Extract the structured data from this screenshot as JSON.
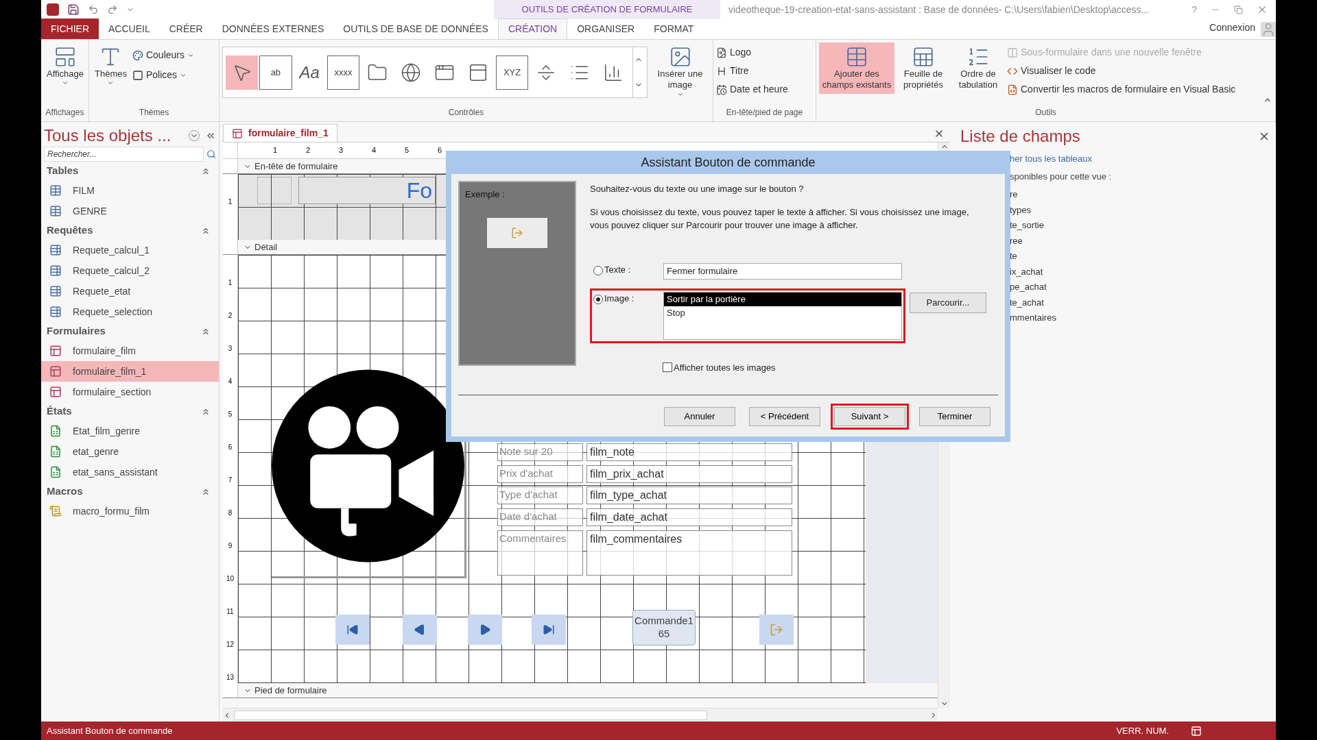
{
  "title_bar": {
    "context_label": "OUTILS DE CRÉATION DE FORMULAIRE",
    "title": "videotheque-19-creation-etat-sans-assistant : Base de données- C:\\Users\\fabien\\Desktop\\access...",
    "help": "?"
  },
  "ribbon_tabs": [
    {
      "label": "FICHIER",
      "kind": "file",
      "selected": false
    },
    {
      "label": "ACCUEIL",
      "kind": "tab",
      "selected": false
    },
    {
      "label": "CRÉER",
      "kind": "tab",
      "selected": false
    },
    {
      "label": "DONNÉES EXTERNES",
      "kind": "tab",
      "selected": false
    },
    {
      "label": "OUTILS DE BASE DE DONNÉES",
      "kind": "tab",
      "selected": false
    },
    {
      "label": "CRÉATION",
      "kind": "tab",
      "selected": true
    },
    {
      "label": "ORGANISER",
      "kind": "tab",
      "selected": false
    },
    {
      "label": "FORMAT",
      "kind": "tab",
      "selected": false
    }
  ],
  "account": "Connexion",
  "ribbon": {
    "views": {
      "label": "Affichages",
      "button": "Affichage"
    },
    "themes": {
      "label": "Thèmes",
      "button": "Thèmes",
      "colors": "Couleurs",
      "fonts": "Polices"
    },
    "controls": {
      "label": "Contrôles",
      "insert_image": "Insérer une image",
      "gallery": [
        {
          "kind": "pointer",
          "selected": true
        },
        {
          "kind": "glyph",
          "glyph": "ab",
          "selected": false
        },
        {
          "kind": "label",
          "glyph": "Aa",
          "selected": false
        },
        {
          "kind": "glyph",
          "glyph": "xxxx",
          "selected": false
        },
        {
          "kind": "folder",
          "selected": false
        },
        {
          "kind": "globe",
          "selected": false
        },
        {
          "kind": "browser",
          "selected": false
        },
        {
          "kind": "window",
          "selected": false
        },
        {
          "kind": "glyph",
          "glyph": "XYZ",
          "selected": false
        },
        {
          "kind": "pagebreak",
          "selected": false
        },
        {
          "kind": "list",
          "selected": false
        },
        {
          "kind": "chart",
          "selected": false
        }
      ]
    },
    "header_footer": {
      "label": "En-tête/pied de page",
      "items": [
        {
          "kind": "logo",
          "label": "Logo"
        },
        {
          "kind": "title",
          "label": "Titre"
        },
        {
          "kind": "datetime",
          "label": "Date et heure"
        }
      ]
    },
    "tools": {
      "label": "Outils",
      "large": [
        {
          "kind": "fields",
          "label": "Ajouter des champs existants",
          "selected": true
        },
        {
          "kind": "sheet",
          "label": "Feuille de propriétés",
          "selected": false
        },
        {
          "kind": "taborder",
          "label": "Ordre de tabulation",
          "selected": false
        }
      ],
      "small": [
        {
          "kind": "subform",
          "label": "Sous-formulaire dans une nouvelle fenêtre",
          "disabled": true
        },
        {
          "kind": "code",
          "label": "Visualiser le code",
          "disabled": false
        },
        {
          "kind": "convert",
          "label": "Convertir les macros de formulaire en Visual Basic",
          "disabled": false
        }
      ]
    }
  },
  "nav_pane": {
    "title": "Tous les objets ...",
    "search": {
      "placeholder": "Rechercher..."
    },
    "groups": [
      {
        "label": "Tables",
        "kind": "table",
        "items": [
          {
            "label": "FILM",
            "selected": false
          },
          {
            "label": "GENRE",
            "selected": false
          }
        ]
      },
      {
        "label": "Requêtes",
        "kind": "query",
        "items": [
          {
            "label": "Requete_calcul_1",
            "selected": false
          },
          {
            "label": "Requete_calcul_2",
            "selected": false
          },
          {
            "label": "Requete_etat",
            "selected": false
          },
          {
            "label": "Requete_selection",
            "selected": false
          }
        ]
      },
      {
        "label": "Formulaires",
        "kind": "form",
        "items": [
          {
            "label": "formulaire_film",
            "selected": false
          },
          {
            "label": "formulaire_film_1",
            "selected": true
          },
          {
            "label": "formulaire_section",
            "selected": false
          }
        ]
      },
      {
        "label": "États",
        "kind": "report",
        "items": [
          {
            "label": "Etat_film_genre",
            "selected": false
          },
          {
            "label": "etat_genre",
            "selected": false
          },
          {
            "label": "etat_sans_assistant",
            "selected": false
          }
        ]
      },
      {
        "label": "Macros",
        "kind": "macro",
        "items": [
          {
            "label": "macro_formu_film",
            "selected": false
          }
        ]
      }
    ]
  },
  "document": {
    "tab": "formulaire_film_1",
    "ruler": [
      "1",
      "2",
      "3",
      "4",
      "5",
      "6"
    ],
    "header": {
      "label": "En-tête de formulaire",
      "title_text": "Fo",
      "ruler": [
        "1"
      ]
    },
    "detail": {
      "label": "Détail",
      "ruler": [
        "1",
        "2",
        "3",
        "4",
        "5",
        "6",
        "7",
        "8",
        "9",
        "10",
        "11",
        "12",
        "13"
      ],
      "rows": [
        {
          "label": "Note sur 20",
          "field": "film_note"
        },
        {
          "label": "Prix d'achat",
          "field": "film_prix_achat"
        },
        {
          "label": "Type d'achat",
          "field": "film_type_achat"
        },
        {
          "label": "Date d'achat",
          "field": "film_date_achat"
        },
        {
          "label": "Commentaires",
          "field": "film_commentaires"
        }
      ],
      "nav_buttons": [
        {
          "kind": "first"
        },
        {
          "kind": "prev"
        },
        {
          "kind": "next"
        },
        {
          "kind": "last"
        }
      ],
      "command_button": "Commande165"
    },
    "footer": {
      "label": "Pied de formulaire"
    }
  },
  "field_list": {
    "title": "Liste de champs",
    "link": "her tous les tableaux",
    "subtitle": "sponibles pour cette vue :",
    "items": [
      "re",
      "types",
      "te_sortie",
      "ree",
      "te",
      "ix_achat",
      "pe_achat",
      "te_achat",
      "mmentaires"
    ]
  },
  "dialog": {
    "title": "Assistant Bouton de commande",
    "example_label": "Exemple :",
    "question": "Souhaitez-vous du texte ou une image sur le bouton ?",
    "explanation": "Si vous choisissez du texte, vous pouvez taper le texte à afficher. Si vous choisissez une image, vous pouvez cliquer sur Parcourir pour trouver une image à afficher.",
    "options": [
      {
        "kind": "text",
        "label": "Texte :",
        "selected": false,
        "highlighted": false,
        "value": "Fermer formulaire"
      },
      {
        "kind": "image",
        "label": "Image :",
        "selected": true,
        "highlighted": true,
        "list": [
          {
            "text": "Sortir par la portière",
            "selected": true
          },
          {
            "text": "Stop",
            "selected": false
          }
        ]
      }
    ],
    "browse": "Parcourir...",
    "show_all": {
      "label": "Afficher toutes les images",
      "checked": false
    },
    "buttons": [
      {
        "label": "Annuler",
        "highlighted": false
      },
      {
        "label": "< Précédent",
        "highlighted": false
      },
      {
        "label": "Suivant >",
        "highlighted": true
      },
      {
        "label": "Terminer",
        "highlighted": false
      }
    ]
  },
  "status_bar": {
    "text": "Assistant Bouton de commande",
    "num_lock": "VERR. NUM."
  }
}
